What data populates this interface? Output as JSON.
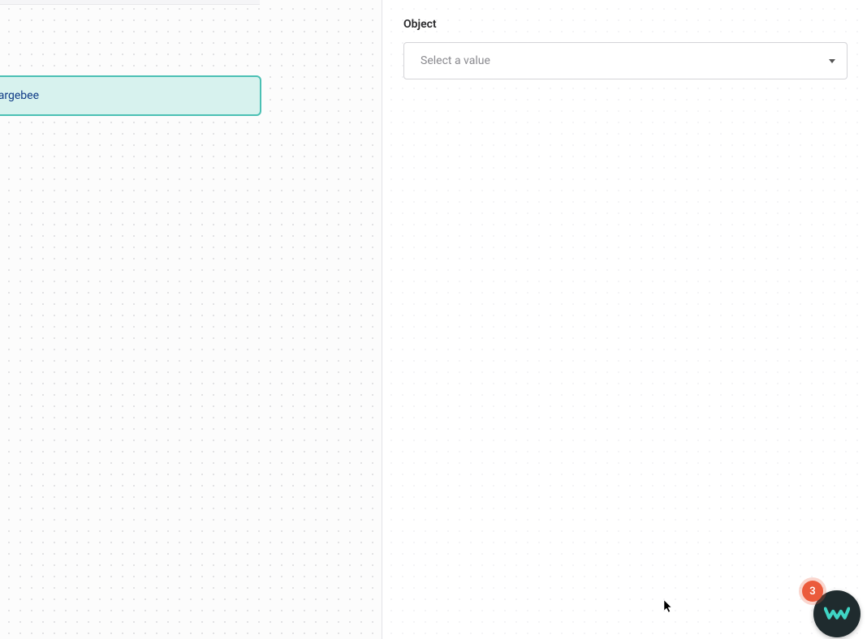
{
  "canvas": {
    "trigger_label": "hargebee"
  },
  "panel": {
    "object_label": "Object",
    "select_placeholder": "Select a value"
  },
  "chat": {
    "badge_count": "3"
  }
}
